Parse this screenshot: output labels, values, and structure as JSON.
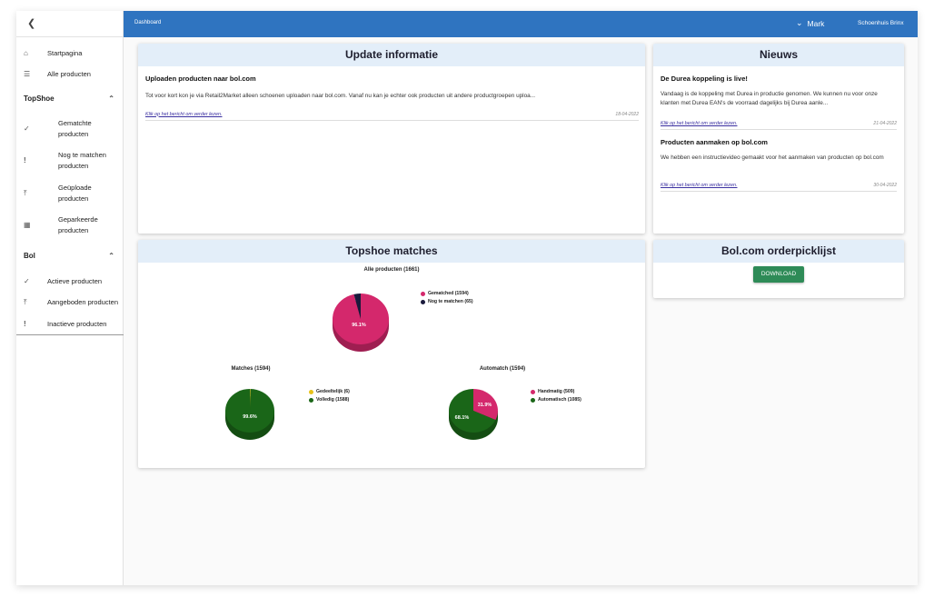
{
  "sidebar": {
    "back_icon": "chevron-left-icon",
    "items_top": [
      {
        "label": "Startpagina",
        "icon": "home-icon"
      },
      {
        "label": "Alle producten",
        "icon": "list-icon"
      }
    ],
    "sections": [
      {
        "title": "TopShoe",
        "items": [
          {
            "label": "Gematchte producten",
            "icon": "check-icon"
          },
          {
            "label": "Nog te matchen producten",
            "icon": "exclamation-icon"
          },
          {
            "label": "Geüploade producten",
            "icon": "upload-icon"
          },
          {
            "label": "Geparkeerde producten",
            "icon": "parked-icon"
          }
        ]
      },
      {
        "title": "Bol",
        "items": [
          {
            "label": "Actieve producten",
            "icon": "check-icon"
          },
          {
            "label": "Aangeboden producten",
            "icon": "upload-icon"
          },
          {
            "label": "Inactieve producten",
            "icon": "exclamation-icon"
          }
        ]
      }
    ]
  },
  "topbar": {
    "breadcrumb": "Dashboard",
    "user": "Mark",
    "shop": "Schoenhuis Brinx"
  },
  "update_card": {
    "title": "Update informatie",
    "post": {
      "title": "Uploaden producten naar bol.com",
      "body": "Tot voor kort kon je via Retail2Market alleen schoenen uploaden naar bol.com. Vanaf nu kan je echter ook producten uit andere productgroepen uploa...",
      "link": "Klik op het bericht om verder lezen.",
      "date": "18-04-2022"
    }
  },
  "news_card": {
    "title": "Nieuws",
    "posts": [
      {
        "title": "De Durea koppeling is live!",
        "body": "Vandaag is de koppeling met Durea in productie genomen. We kunnen nu voor onze klanten met Durea EAN's de voorraad dagelijks bij Durea aanle...",
        "link": "Klik op het bericht om verder lezen.",
        "date": "21-04-2022"
      },
      {
        "title": "Producten aanmaken op bol.com",
        "body": "We hebben een instructievideo gemaakt voor het aanmaken van producten op bol.com",
        "link": "Klik op het bericht om verder lezen.",
        "date": "30-04-2022"
      }
    ]
  },
  "matches_card": {
    "title": "Topshoe matches"
  },
  "orderpick_card": {
    "title": "Bol.com orderpicklijst",
    "download_label": "DOWNLOAD"
  },
  "colors": {
    "pink": "#d4286c",
    "dark": "#1a1a3c",
    "green": "#1a6618",
    "yellow": "#e8c21a",
    "blue": "#2f74c0",
    "button_green": "#2e8b57"
  },
  "chart_data": [
    {
      "type": "pie",
      "title": "Alle producten (1661)",
      "slices": [
        {
          "label": "Gematched (1594)",
          "value": 1594,
          "color": "#d4286c"
        },
        {
          "label": "Nog te matchen (65)",
          "value": 65,
          "color": "#1a1a3c"
        }
      ],
      "data_labels": [
        "96.1%"
      ],
      "legend": "right"
    },
    {
      "type": "pie",
      "title": "Matches (1594)",
      "slices": [
        {
          "label": "Gedeeltelijk (6)",
          "value": 6,
          "color": "#e8c21a"
        },
        {
          "label": "Volledig (1588)",
          "value": 1588,
          "color": "#1a6618"
        }
      ],
      "data_labels": [
        "99.6%"
      ],
      "legend": "right"
    },
    {
      "type": "pie",
      "title": "Automatch (1594)",
      "slices": [
        {
          "label": "Handmatig (509)",
          "value": 509,
          "color": "#d4286c"
        },
        {
          "label": "Automatisch (1085)",
          "value": 1085,
          "color": "#1a6618"
        }
      ],
      "data_labels": [
        "31.9%",
        "68.1%"
      ],
      "legend": "right"
    }
  ]
}
